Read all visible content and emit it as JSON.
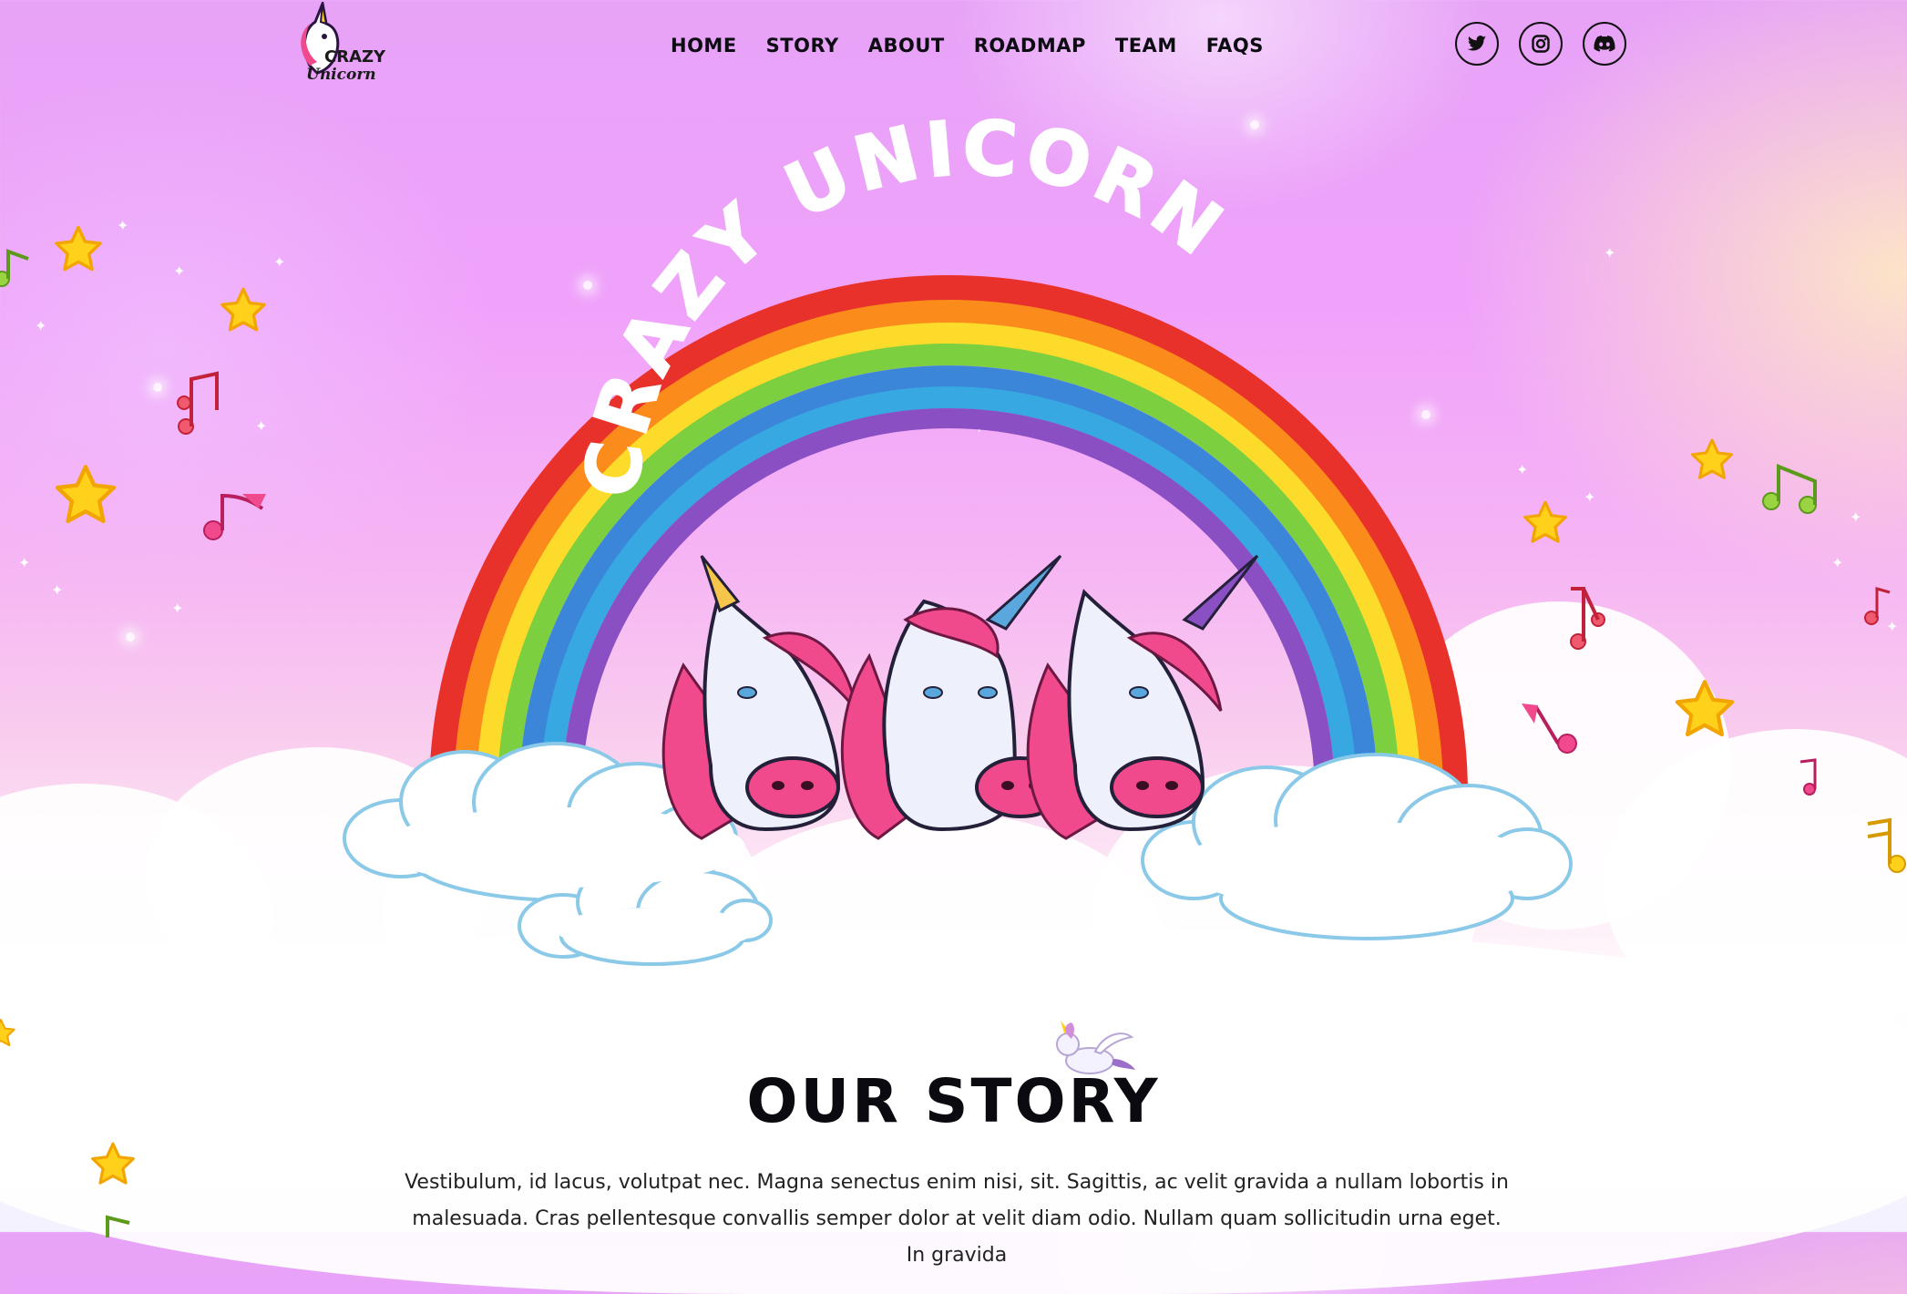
{
  "brand": {
    "logo_line1": "CRAZY",
    "logo_line2": "Unicorn"
  },
  "nav": {
    "items": [
      {
        "label": "HOME"
      },
      {
        "label": "STORY"
      },
      {
        "label": "ABOUT"
      },
      {
        "label": "ROADMAP"
      },
      {
        "label": "TEAM"
      },
      {
        "label": "FAQS"
      }
    ]
  },
  "socials": [
    {
      "icon": "twitter-icon"
    },
    {
      "icon": "instagram-icon"
    },
    {
      "icon": "discord-icon"
    }
  ],
  "hero": {
    "arc_title": "CRAZY UNICORN"
  },
  "story": {
    "title": "OUR STORY",
    "text": "Vestibulum, id lacus, volutpat nec. Magna senectus enim nisi, sit. Sagittis, ac velit gravida a nullam lobortis in malesuada. Cras pellentesque convallis semper dolor at velit diam odio. Nullam quam sollicitudin urna eget. In gravida"
  },
  "colors": {
    "rainbow": [
      "#e8312a",
      "#fb8c1b",
      "#fddb2a",
      "#7ccf3f",
      "#3b86d9",
      "#37a8e2",
      "#8b4fc4"
    ],
    "unicorn_mane": "#f0498c",
    "star": "#ffd11a"
  }
}
